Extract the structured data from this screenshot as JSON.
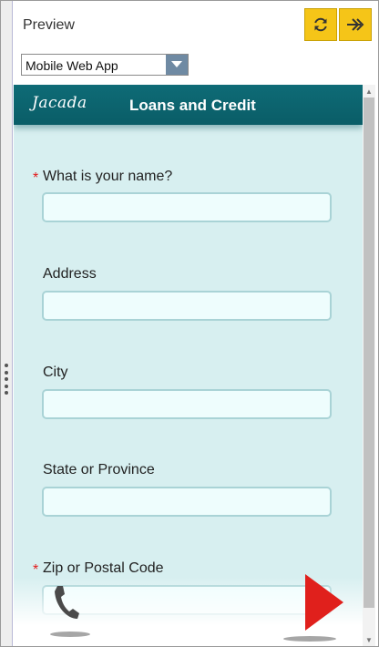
{
  "panel": {
    "title": "Preview",
    "refresh_icon": "refresh-icon",
    "next_icon": "double-arrow-right-icon",
    "accent_color": "#f5c518"
  },
  "device_select": {
    "selected": "Mobile Web App"
  },
  "app": {
    "logo": "Jacada",
    "title": "Loans and Credit",
    "header_color": "#0e6b76",
    "background_color": "#d7eff0"
  },
  "form": {
    "fields": [
      {
        "label": "What is your name?",
        "required": true,
        "value": ""
      },
      {
        "label": "Address",
        "required": false,
        "value": ""
      },
      {
        "label": "City",
        "required": false,
        "value": ""
      },
      {
        "label": "State or Province",
        "required": false,
        "value": ""
      },
      {
        "label": "Zip or Postal Code",
        "required": true,
        "value": ""
      }
    ],
    "required_marker": "*"
  },
  "actions": {
    "call_icon": "phone-icon",
    "next_icon": "play-arrow-icon",
    "next_color": "#e0201c"
  }
}
